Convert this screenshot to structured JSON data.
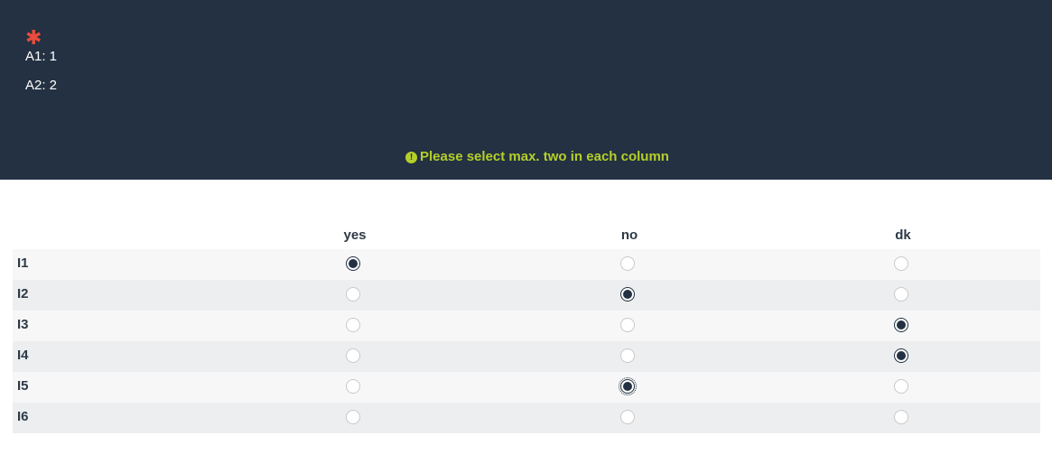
{
  "header": {
    "required_marker": "✱",
    "answers": [
      "A1: 1",
      "A2: 2"
    ],
    "validation_message": "Please select max. two in each column",
    "validation_icon": "exclamation-circle-icon",
    "colors": {
      "background": "#233142",
      "required": "#e74c3c",
      "validation": "#b5cf2a"
    }
  },
  "grid": {
    "columns": [
      "yes",
      "no",
      "dk"
    ],
    "rows": [
      {
        "label": "I1",
        "selected": "yes"
      },
      {
        "label": "I2",
        "selected": "no"
      },
      {
        "label": "I3",
        "selected": "dk"
      },
      {
        "label": "I4",
        "selected": "dk"
      },
      {
        "label": "I5",
        "selected": "no",
        "focused": true
      },
      {
        "label": "I6",
        "selected": null
      }
    ]
  }
}
